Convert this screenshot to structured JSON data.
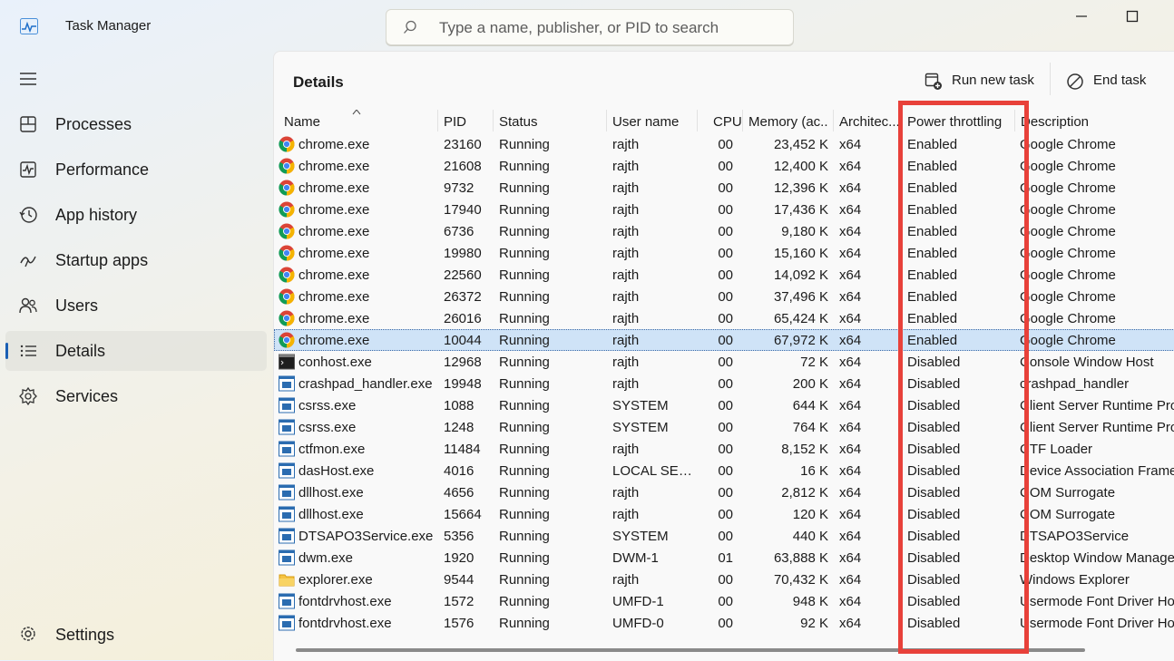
{
  "app": {
    "title": "Task Manager"
  },
  "search": {
    "placeholder": "Type a name, publisher, or PID to search"
  },
  "nav": {
    "items": [
      {
        "label": "Processes",
        "icon": "processes-icon"
      },
      {
        "label": "Performance",
        "icon": "performance-icon"
      },
      {
        "label": "App history",
        "icon": "history-icon"
      },
      {
        "label": "Startup apps",
        "icon": "startup-icon"
      },
      {
        "label": "Users",
        "icon": "users-icon"
      },
      {
        "label": "Details",
        "icon": "details-icon",
        "active": true
      },
      {
        "label": "Services",
        "icon": "services-icon"
      }
    ],
    "settings_label": "Settings"
  },
  "details": {
    "title": "Details",
    "run_new_task": "Run new task",
    "end_task": "End task",
    "columns": {
      "name": "Name",
      "pid": "PID",
      "status": "Status",
      "user": "User name",
      "cpu": "CPU",
      "memory": "Memory (ac...",
      "arch": "Architec...",
      "power": "Power throttling",
      "desc": "Description"
    },
    "rows": [
      {
        "name": "chrome.exe",
        "pid": "23160",
        "status": "Running",
        "user": "rajth",
        "cpu": "00",
        "mem": "23,452 K",
        "arch": "x64",
        "pt": "Enabled",
        "desc": "Google Chrome",
        "icon": "chrome"
      },
      {
        "name": "chrome.exe",
        "pid": "21608",
        "status": "Running",
        "user": "rajth",
        "cpu": "00",
        "mem": "12,400 K",
        "arch": "x64",
        "pt": "Enabled",
        "desc": "Google Chrome",
        "icon": "chrome"
      },
      {
        "name": "chrome.exe",
        "pid": "9732",
        "status": "Running",
        "user": "rajth",
        "cpu": "00",
        "mem": "12,396 K",
        "arch": "x64",
        "pt": "Enabled",
        "desc": "Google Chrome",
        "icon": "chrome"
      },
      {
        "name": "chrome.exe",
        "pid": "17940",
        "status": "Running",
        "user": "rajth",
        "cpu": "00",
        "mem": "17,436 K",
        "arch": "x64",
        "pt": "Enabled",
        "desc": "Google Chrome",
        "icon": "chrome"
      },
      {
        "name": "chrome.exe",
        "pid": "6736",
        "status": "Running",
        "user": "rajth",
        "cpu": "00",
        "mem": "9,180 K",
        "arch": "x64",
        "pt": "Enabled",
        "desc": "Google Chrome",
        "icon": "chrome"
      },
      {
        "name": "chrome.exe",
        "pid": "19980",
        "status": "Running",
        "user": "rajth",
        "cpu": "00",
        "mem": "15,160 K",
        "arch": "x64",
        "pt": "Enabled",
        "desc": "Google Chrome",
        "icon": "chrome"
      },
      {
        "name": "chrome.exe",
        "pid": "22560",
        "status": "Running",
        "user": "rajth",
        "cpu": "00",
        "mem": "14,092 K",
        "arch": "x64",
        "pt": "Enabled",
        "desc": "Google Chrome",
        "icon": "chrome"
      },
      {
        "name": "chrome.exe",
        "pid": "26372",
        "status": "Running",
        "user": "rajth",
        "cpu": "00",
        "mem": "37,496 K",
        "arch": "x64",
        "pt": "Enabled",
        "desc": "Google Chrome",
        "icon": "chrome"
      },
      {
        "name": "chrome.exe",
        "pid": "26016",
        "status": "Running",
        "user": "rajth",
        "cpu": "00",
        "mem": "65,424 K",
        "arch": "x64",
        "pt": "Enabled",
        "desc": "Google Chrome",
        "icon": "chrome"
      },
      {
        "name": "chrome.exe",
        "pid": "10044",
        "status": "Running",
        "user": "rajth",
        "cpu": "00",
        "mem": "67,972 K",
        "arch": "x64",
        "pt": "Enabled",
        "desc": "Google Chrome",
        "icon": "chrome",
        "selected": true
      },
      {
        "name": "conhost.exe",
        "pid": "12968",
        "status": "Running",
        "user": "rajth",
        "cpu": "00",
        "mem": "72 K",
        "arch": "x64",
        "pt": "Disabled",
        "desc": "Console Window Host",
        "icon": "console"
      },
      {
        "name": "crashpad_handler.exe",
        "pid": "19948",
        "status": "Running",
        "user": "rajth",
        "cpu": "00",
        "mem": "200 K",
        "arch": "x64",
        "pt": "Disabled",
        "desc": "crashpad_handler",
        "icon": "app"
      },
      {
        "name": "csrss.exe",
        "pid": "1088",
        "status": "Running",
        "user": "SYSTEM",
        "cpu": "00",
        "mem": "644 K",
        "arch": "x64",
        "pt": "Disabled",
        "desc": "Client Server Runtime Proc",
        "icon": "app"
      },
      {
        "name": "csrss.exe",
        "pid": "1248",
        "status": "Running",
        "user": "SYSTEM",
        "cpu": "00",
        "mem": "764 K",
        "arch": "x64",
        "pt": "Disabled",
        "desc": "Client Server Runtime Proc",
        "icon": "app"
      },
      {
        "name": "ctfmon.exe",
        "pid": "11484",
        "status": "Running",
        "user": "rajth",
        "cpu": "00",
        "mem": "8,152 K",
        "arch": "x64",
        "pt": "Disabled",
        "desc": "CTF Loader",
        "icon": "app"
      },
      {
        "name": "dasHost.exe",
        "pid": "4016",
        "status": "Running",
        "user": "LOCAL SER...",
        "cpu": "00",
        "mem": "16 K",
        "arch": "x64",
        "pt": "Disabled",
        "desc": "Device Association Framew",
        "icon": "app"
      },
      {
        "name": "dllhost.exe",
        "pid": "4656",
        "status": "Running",
        "user": "rajth",
        "cpu": "00",
        "mem": "2,812 K",
        "arch": "x64",
        "pt": "Disabled",
        "desc": "COM Surrogate",
        "icon": "app"
      },
      {
        "name": "dllhost.exe",
        "pid": "15664",
        "status": "Running",
        "user": "rajth",
        "cpu": "00",
        "mem": "120 K",
        "arch": "x64",
        "pt": "Disabled",
        "desc": "COM Surrogate",
        "icon": "app"
      },
      {
        "name": "DTSAPO3Service.exe",
        "pid": "5356",
        "status": "Running",
        "user": "SYSTEM",
        "cpu": "00",
        "mem": "440 K",
        "arch": "x64",
        "pt": "Disabled",
        "desc": "DTSAPO3Service",
        "icon": "app"
      },
      {
        "name": "dwm.exe",
        "pid": "1920",
        "status": "Running",
        "user": "DWM-1",
        "cpu": "01",
        "mem": "63,888 K",
        "arch": "x64",
        "pt": "Disabled",
        "desc": "Desktop Window Manager",
        "icon": "app"
      },
      {
        "name": "explorer.exe",
        "pid": "9544",
        "status": "Running",
        "user": "rajth",
        "cpu": "00",
        "mem": "70,432 K",
        "arch": "x64",
        "pt": "Disabled",
        "desc": "Windows Explorer",
        "icon": "folder"
      },
      {
        "name": "fontdrvhost.exe",
        "pid": "1572",
        "status": "Running",
        "user": "UMFD-1",
        "cpu": "00",
        "mem": "948 K",
        "arch": "x64",
        "pt": "Disabled",
        "desc": "Usermode Font Driver Hos",
        "icon": "app"
      },
      {
        "name": "fontdrvhost.exe",
        "pid": "1576",
        "status": "Running",
        "user": "UMFD-0",
        "cpu": "00",
        "mem": "92 K",
        "arch": "x64",
        "pt": "Disabled",
        "desc": "Usermode Font Driver Hos",
        "icon": "app"
      }
    ]
  },
  "colors": {
    "highlight": "#e8413a",
    "selection": "#cfe3f7",
    "accent": "#1a5fb4"
  }
}
